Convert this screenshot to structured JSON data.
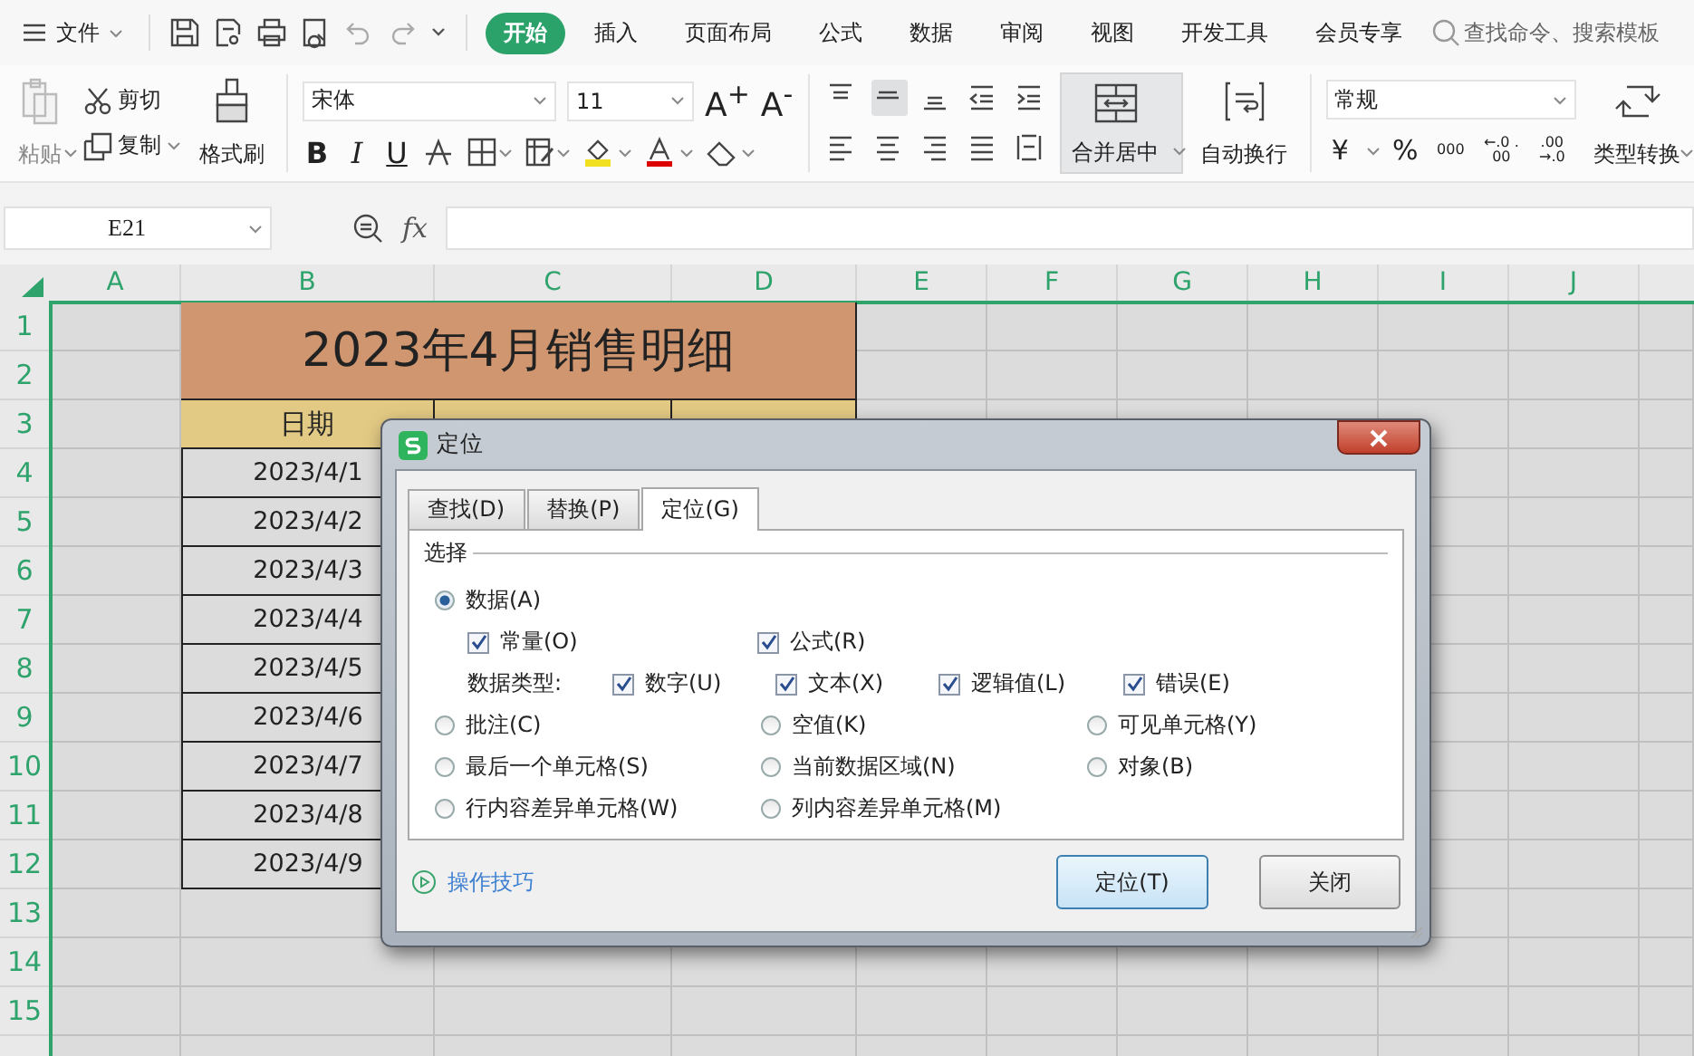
{
  "menu": {
    "file_label": "文件",
    "tabs": [
      {
        "label": "开始",
        "selected": true
      },
      {
        "label": "插入",
        "selected": false
      },
      {
        "label": "页面布局",
        "selected": false
      },
      {
        "label": "公式",
        "selected": false
      },
      {
        "label": "数据",
        "selected": false
      },
      {
        "label": "审阅",
        "selected": false
      },
      {
        "label": "视图",
        "selected": false
      },
      {
        "label": "开发工具",
        "selected": false
      },
      {
        "label": "会员专享",
        "selected": false
      }
    ],
    "search": {
      "placeholder": "查找命令、搜索模板"
    }
  },
  "ribbon": {
    "paste": "粘贴",
    "cut": "剪切",
    "copy": "复制",
    "format_painter": "格式刷",
    "font": "宋体",
    "font_size": "11",
    "grow_font": "A$^{+}$",
    "shrink_font": "A$^{-}$",
    "bold": "B",
    "italic": "I",
    "underline": "U",
    "merge_center": "合并居中",
    "wrap_text": "自动换行",
    "number_format": "常规",
    "currency": "¥",
    "percent": "%",
    "thousands": "000",
    "increase_decimal": "←.0 .00",
    "decrease_decimal": ".00 →.0",
    "convert_type": "类型转换"
  },
  "formula_bar": {
    "name_box": "E21",
    "fx": "fx"
  },
  "sheet": {
    "all_selected": true,
    "columns": [
      "A",
      "B",
      "C",
      "D",
      "E",
      "F",
      "G",
      "H",
      "I",
      "J"
    ],
    "rows": [
      "1",
      "2",
      "3",
      "4",
      "5",
      "6",
      "7",
      "8",
      "9",
      "10",
      "11",
      "12",
      "13",
      "14",
      "15"
    ],
    "title": "2023年4月销售明细",
    "header": "日期",
    "dates": [
      "2023/4/1",
      "2023/4/2",
      "2023/4/3",
      "2023/4/4",
      "2023/4/5",
      "2023/4/6",
      "2023/4/7",
      "2023/4/8",
      "2023/4/9"
    ]
  },
  "dialog": {
    "title": "定位",
    "tabs": [
      {
        "label": "查找(D)",
        "selected": false
      },
      {
        "label": "替换(P)",
        "selected": false
      },
      {
        "label": "定位(G)",
        "selected": true
      }
    ],
    "group_label": "选择",
    "option_rows": [
      {
        "kind": "main",
        "items": [
          {
            "kind": "radio",
            "label": "数据(A)",
            "selected": true
          }
        ]
      },
      {
        "kind": "sub",
        "items": [
          {
            "kind": "checkbox",
            "label": "常量(O)",
            "checked": true
          },
          {
            "kind": "checkbox",
            "label": "公式(R)",
            "checked": true
          }
        ]
      },
      {
        "kind": "types",
        "items": [
          {
            "kind": "text",
            "label": "数据类型:"
          },
          {
            "kind": "checkbox",
            "label": "数字(U)",
            "checked": true
          },
          {
            "kind": "checkbox",
            "label": "文本(X)",
            "checked": true
          },
          {
            "kind": "checkbox",
            "label": "逻辑值(L)",
            "checked": true
          },
          {
            "kind": "checkbox",
            "label": "错误(E)",
            "checked": true
          }
        ]
      },
      {
        "kind": "main",
        "items": [
          {
            "kind": "radio",
            "label": "批注(C)",
            "selected": false
          },
          {
            "kind": "radio",
            "label": "空值(K)",
            "selected": false
          },
          {
            "kind": "radio",
            "label": "可见单元格(Y)",
            "selected": false
          }
        ]
      },
      {
        "kind": "main",
        "items": [
          {
            "kind": "radio",
            "label": "最后一个单元格(S)",
            "selected": false
          },
          {
            "kind": "radio",
            "label": "当前数据区域(N)",
            "selected": false
          },
          {
            "kind": "radio",
            "label": "对象(B)",
            "selected": false
          }
        ]
      },
      {
        "kind": "main",
        "items": [
          {
            "kind": "radio",
            "label": "行内容差异单元格(W)",
            "selected": false
          },
          {
            "kind": "radio",
            "label": "列内容差异单元格(M)",
            "selected": false
          }
        ]
      }
    ],
    "tips_link": "操作技巧",
    "buttons": [
      {
        "label": "定位(T)",
        "kind": "default"
      },
      {
        "label": "关闭",
        "kind": "normal"
      }
    ]
  }
}
